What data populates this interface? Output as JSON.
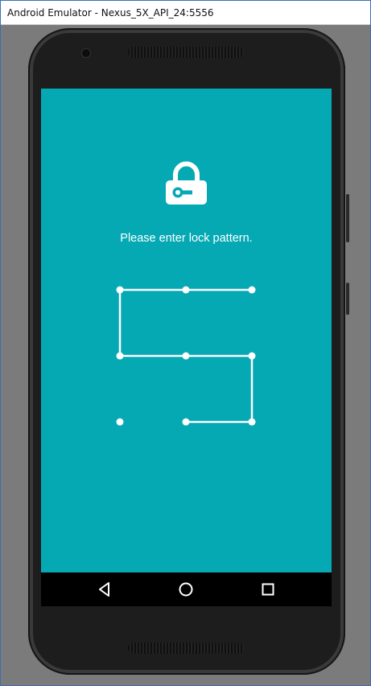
{
  "window": {
    "title": "Android Emulator - Nexus_5X_API_24:5556"
  },
  "lockscreen": {
    "prompt": "Please enter lock pattern.",
    "icon": "lock-icon",
    "background_color": "#05a9b4",
    "pattern_color": "#ffffff",
    "pattern_grid": {
      "rows": 3,
      "cols": 3
    },
    "entered_sequence": [
      {
        "row": 0,
        "col": 2
      },
      {
        "row": 0,
        "col": 1
      },
      {
        "row": 0,
        "col": 0
      },
      {
        "row": 1,
        "col": 0
      },
      {
        "row": 1,
        "col": 1
      },
      {
        "row": 1,
        "col": 2
      },
      {
        "row": 2,
        "col": 2
      },
      {
        "row": 2,
        "col": 1
      }
    ]
  },
  "navigation": {
    "back": "back-icon",
    "home": "home-icon",
    "recents": "recents-icon"
  }
}
